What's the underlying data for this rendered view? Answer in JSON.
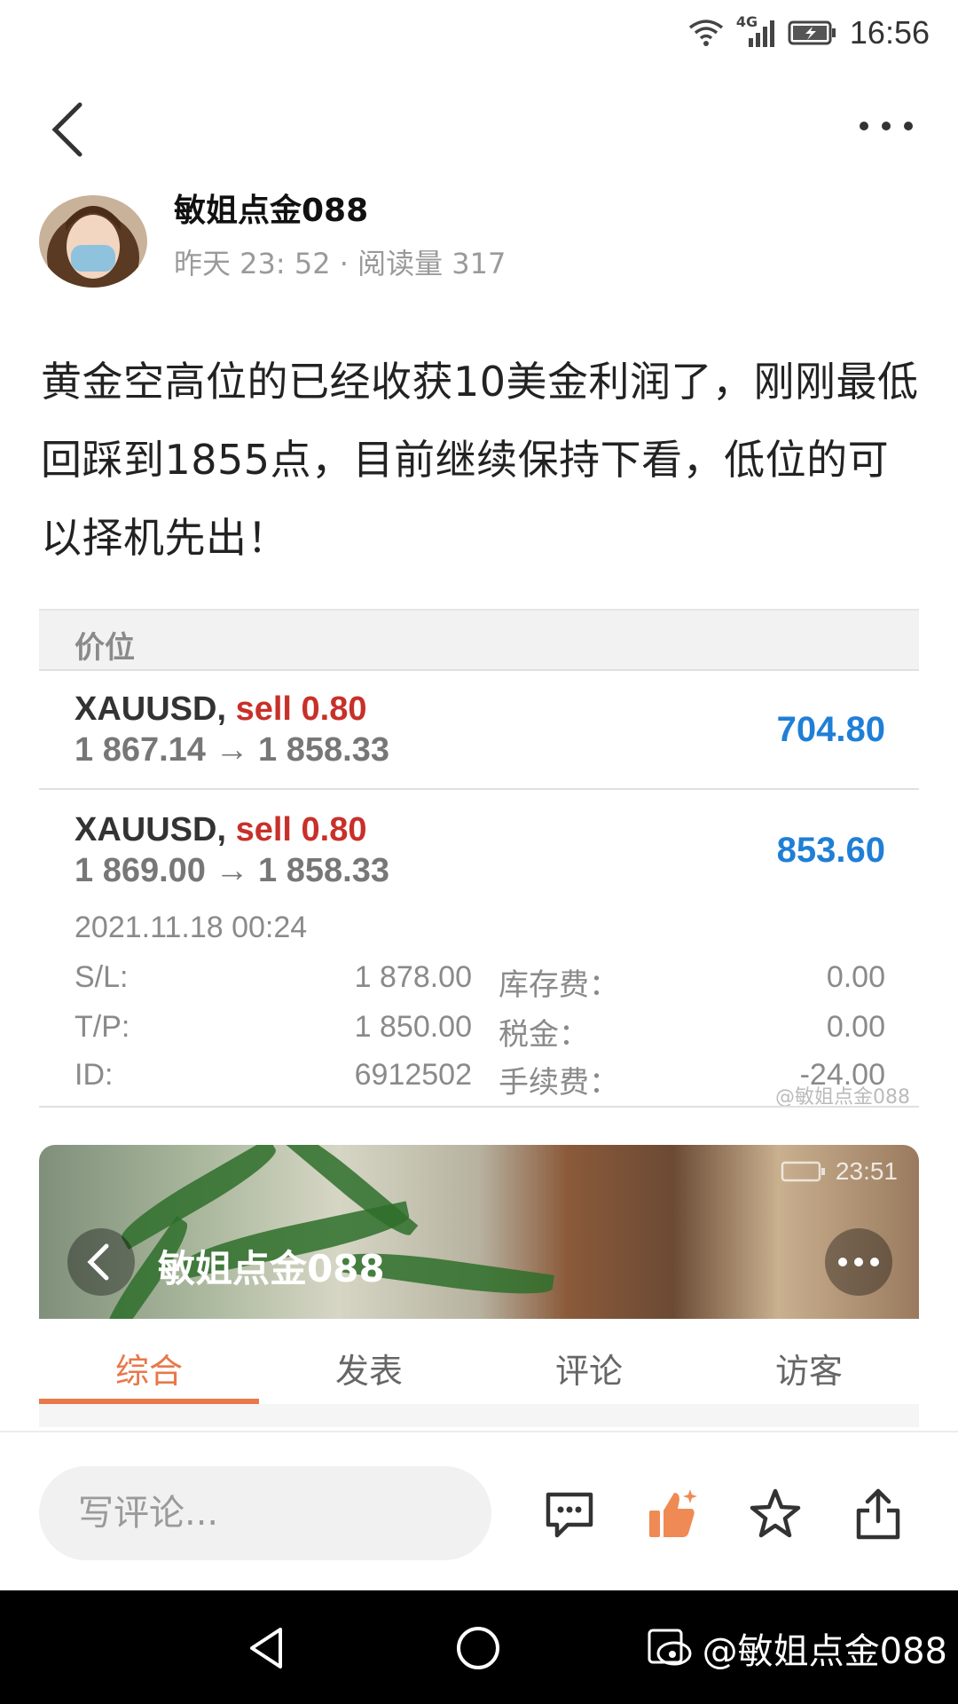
{
  "status_bar": {
    "network": "4G",
    "time": "16:56"
  },
  "author": {
    "name": "敏姐点金088",
    "time": "昨天 23: 52",
    "separator": "·",
    "reads": "阅读量 317"
  },
  "post": {
    "text": "黄金空高位的已经收获10美金利润了，刚刚最低回踩到1855点，目前继续保持下看，低位的可以择机先出！"
  },
  "trade_card": {
    "header": "价位",
    "trades": [
      {
        "symbol": "XAUUSD,",
        "side": "sell 0.80",
        "open": "1 867.14",
        "arrow": "→",
        "close": "1 858.33",
        "profit": "704.80"
      },
      {
        "symbol": "XAUUSD,",
        "side": "sell 0.80",
        "open": "1 869.00",
        "arrow": "→",
        "close": "1 858.33",
        "profit": "853.60"
      }
    ],
    "date": "2021.11.18 00:24",
    "details": [
      {
        "label": "S/L:",
        "value": "1 878.00",
        "label2": "库存费：",
        "value2": "0.00"
      },
      {
        "label": "T/P:",
        "value": "1 850.00",
        "label2": "税金：",
        "value2": "0.00"
      },
      {
        "label": "ID:",
        "value": "6912502",
        "label2": "手续费：",
        "value2": "-24.00"
      }
    ],
    "watermark": "@敏姐点金088"
  },
  "banner": {
    "status_time": "23:51",
    "title": "敏姐点金088"
  },
  "tabs": [
    "综合",
    "发表",
    "评论",
    "访客"
  ],
  "action_bar": {
    "comment_placeholder": "写评论..."
  },
  "nav": {
    "watermark": "@敏姐点金088"
  },
  "colors": {
    "accent": "#e8784a",
    "sell": "#c8302a",
    "profit": "#1f7fd6"
  }
}
